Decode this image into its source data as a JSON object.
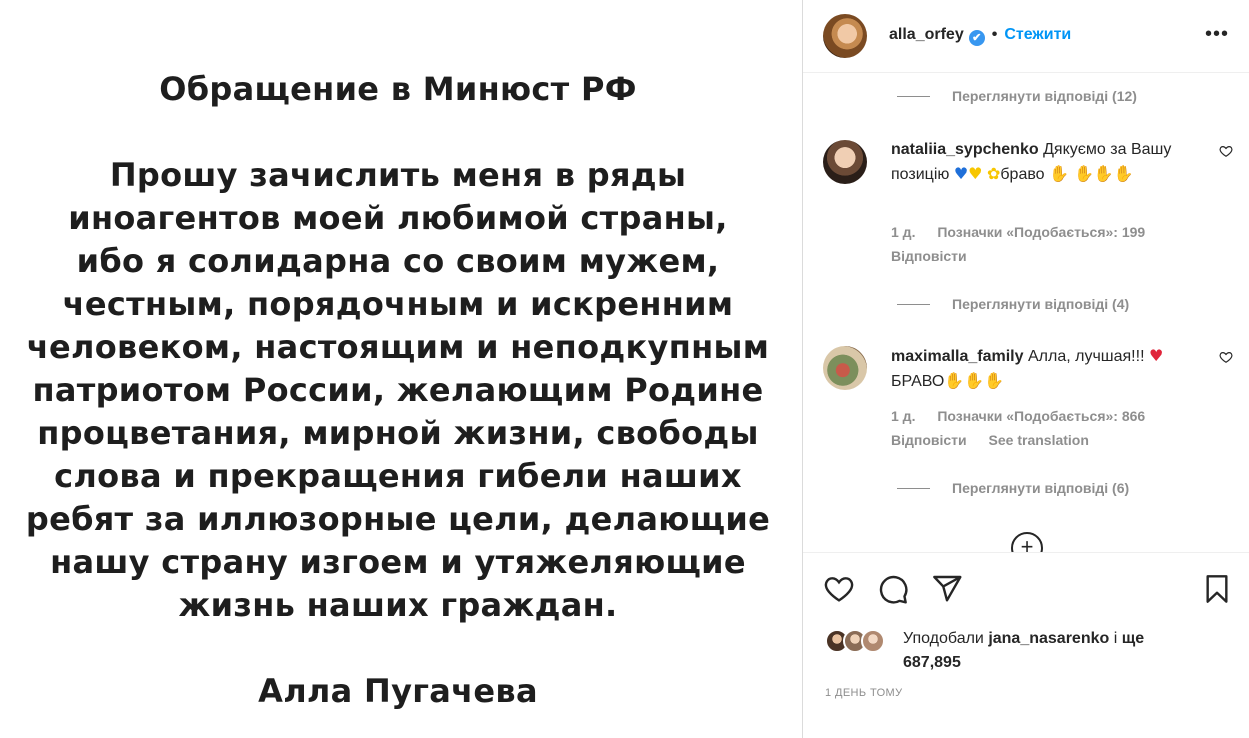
{
  "post": {
    "title": "Обращение в Минюст РФ",
    "body_lines": [
      "Прошу зачислить меня в ряды",
      "иноагентов моей любимой страны,",
      "ибо я солидарна со своим мужем,",
      "честным, порядочным и искренним",
      "человеком, настоящим и неподкупным",
      "патриотом России, желающим Родине",
      "процветания, мирной жизни, свободы",
      "слова и прекращения гибели наших",
      "ребят за иллюзорные цели, делающие",
      "нашу страну изгоем и утяжеляющие",
      "жизнь наших граждан."
    ],
    "signature": "Алла Пугачева"
  },
  "header": {
    "username": "alla_orfey",
    "verified_icon": "✔",
    "separator": "•",
    "follow_label": "Стежити",
    "more_icon": "•••"
  },
  "comments": {
    "view_replies_1": "Переглянути відповіді (12)",
    "c1": {
      "username": "nataliia_sypchenko",
      "text_a": " Дякуємо за Вашу позицію ",
      "heart_blue": "♥",
      "heart_yellow": "♥",
      "flower": "✿",
      "text_b": "браво ",
      "claps": "✋ ✋✋✋",
      "time": "1 д.",
      "likes": "Позначки «Подобається»: 199",
      "reply": "Відповісти"
    },
    "view_replies_2": "Переглянути відповіді (4)",
    "c2": {
      "username": "maximalla_family",
      "text_a": " Алла, лучшая!!! ",
      "heart_red": "♥",
      "text_b": " БРАВО",
      "claps": "✋✋✋",
      "time": "1 д.",
      "likes": "Позначки «Подобається»: 866",
      "reply": "Відповісти",
      "translate": "See translation"
    },
    "view_replies_3": "Переглянути відповіді (6)",
    "load_more_icon": "+"
  },
  "footer": {
    "liked_by_prefix": "Уподобали ",
    "liked_by_user": "jana_nasarenko",
    "liked_by_mid": " і ",
    "liked_by_rest": "ще 687,895",
    "time_ago": "1 ДЕНЬ ТОМУ"
  }
}
